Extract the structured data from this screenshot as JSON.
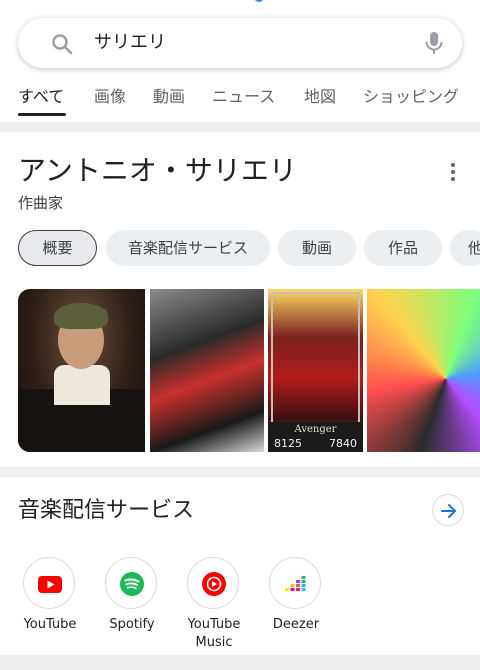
{
  "search": {
    "query": "サリエリ"
  },
  "tabs": [
    {
      "label": "すべて",
      "active": true
    },
    {
      "label": "画像",
      "active": false
    },
    {
      "label": "動画",
      "active": false
    },
    {
      "label": "ニュース",
      "active": false
    },
    {
      "label": "地図",
      "active": false
    },
    {
      "label": "ショッピング",
      "active": false
    }
  ],
  "entity": {
    "title": "アントニオ・サリエリ",
    "subtitle": "作曲家"
  },
  "chips": [
    {
      "label": "概要",
      "selected": true
    },
    {
      "label": "音楽配信サービス",
      "selected": false
    },
    {
      "label": "動画",
      "selected": false
    },
    {
      "label": "作品",
      "selected": false
    },
    {
      "label": "他",
      "selected": false
    }
  ],
  "images": {
    "card_class": "Avenger",
    "card_atk": "8125",
    "card_hp": "7840"
  },
  "music_section": {
    "heading": "音楽配信サービス",
    "services": [
      {
        "label": "YouTube",
        "icon": "youtube-icon",
        "color": "#ff0000"
      },
      {
        "label": "Spotify",
        "icon": "spotify-icon",
        "color": "#1db954"
      },
      {
        "label": "YouTube\nMusic",
        "icon": "youtube-music-icon",
        "color": "#ff0000"
      },
      {
        "label": "Deezer",
        "icon": "deezer-icon",
        "color": "#ef5466"
      }
    ]
  },
  "colors": {
    "accent_blue": "#1a73e8",
    "text_primary": "#202124",
    "text_secondary": "#5f6368",
    "chip_background": "#eceff1"
  }
}
